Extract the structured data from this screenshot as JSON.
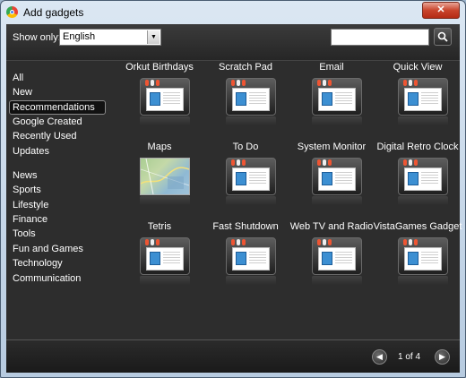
{
  "window": {
    "title": "Add gadgets",
    "close_label": "✕"
  },
  "filter": {
    "label": "Show only:",
    "language": "English",
    "search_placeholder": ""
  },
  "sidebar": {
    "categories": [
      "All",
      "New",
      "Recommendations",
      "Google Created",
      "Recently Used",
      "Updates"
    ],
    "topics": [
      "News",
      "Sports",
      "Lifestyle",
      "Finance",
      "Tools",
      "Fun and Games",
      "Technology",
      "Communication"
    ],
    "selected": "Recommendations"
  },
  "gadgets": [
    {
      "name": "Orkut Birthdays",
      "icon": "gadget-thumbnail-icon"
    },
    {
      "name": "Scratch Pad",
      "icon": "gadget-thumbnail-icon"
    },
    {
      "name": "Email",
      "icon": "gadget-thumbnail-icon"
    },
    {
      "name": "Quick View",
      "icon": "gadget-thumbnail-icon"
    },
    {
      "name": "Maps",
      "icon": "map-thumbnail-icon"
    },
    {
      "name": "To Do",
      "icon": "gadget-thumbnail-icon"
    },
    {
      "name": "System Monitor",
      "icon": "gadget-thumbnail-icon"
    },
    {
      "name": "Digital Retro Clock",
      "icon": "gadget-thumbnail-icon"
    },
    {
      "name": "Tetris",
      "icon": "gadget-thumbnail-icon"
    },
    {
      "name": "Fast Shutdown",
      "icon": "gadget-thumbnail-icon"
    },
    {
      "name": "Web TV and Radio",
      "icon": "gadget-thumbnail-icon"
    },
    {
      "name": "VistaGames Gadget",
      "icon": "gadget-thumbnail-icon"
    }
  ],
  "pager": {
    "text": "1 of 4",
    "prev_icon": "previous-arrow-icon",
    "next_icon": "next-arrow-icon"
  },
  "colors": {
    "background": "#2d2d2d",
    "selected_border": "#8a8a8a",
    "close_button": "#c9442c"
  }
}
